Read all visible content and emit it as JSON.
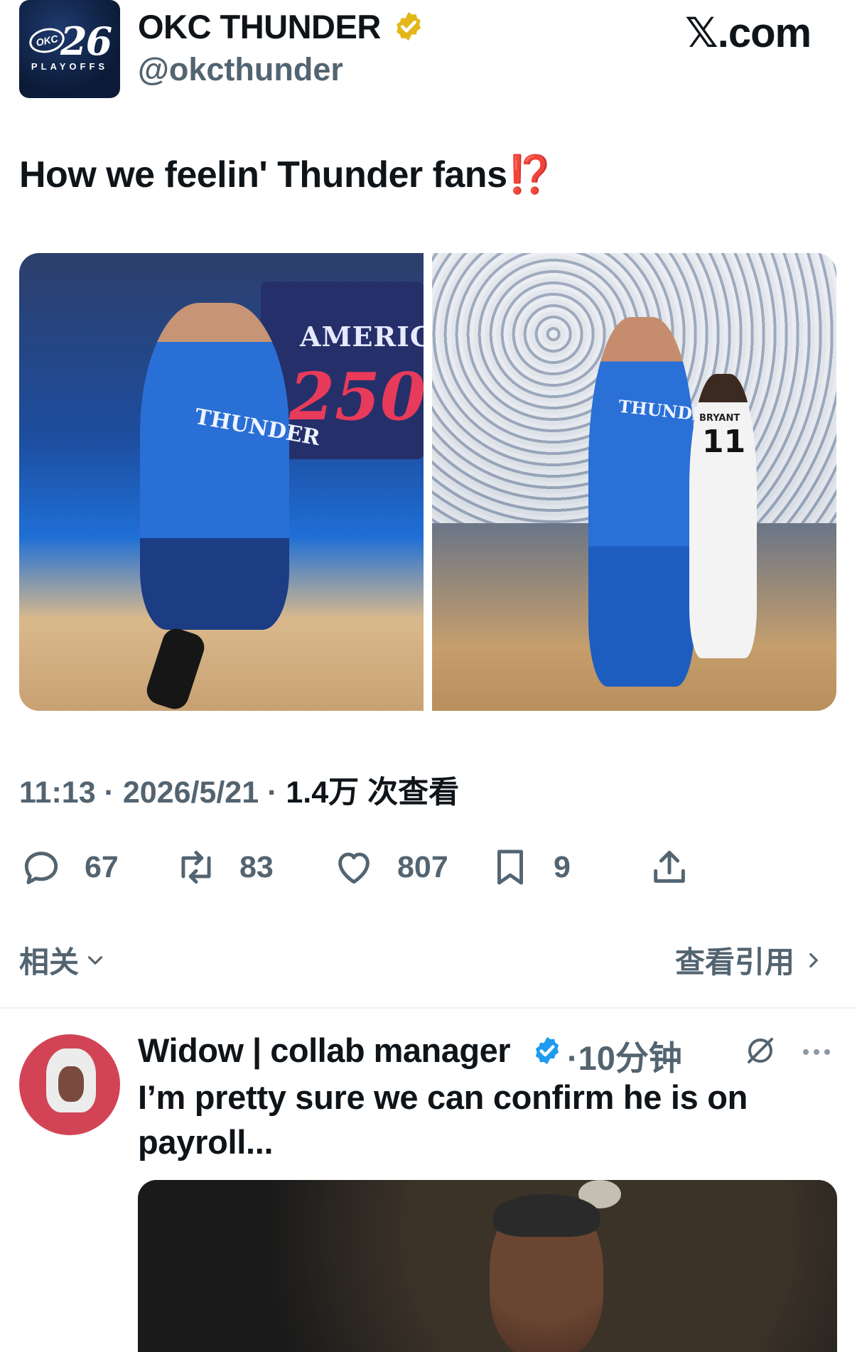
{
  "header": {
    "avatar_logo_number": "26",
    "avatar_logo_initials": "OKC",
    "avatar_logo_caption": "PLAYOFFS",
    "account_name": "OKC THUNDER",
    "handle": "@okcthunder",
    "site_label": "𝕏.com"
  },
  "tweet": {
    "text": "How we feelin' Thunder fans",
    "emoji": "⁉️",
    "photo1_board_text": "AMERICA",
    "photo1_board_number": "250",
    "photo1_jersey": "THUNDER",
    "photo2_jersey": "THUNDER",
    "photo2_opponent_name": "BRYANT",
    "photo2_opponent_number": "11",
    "time": "11:13",
    "date": "2026/5/21",
    "views": "1.4万 次查看",
    "separator": " · "
  },
  "actions": {
    "replies": "67",
    "reposts": "83",
    "likes": "807",
    "bookmarks": "9"
  },
  "related_bar": {
    "related_label": "相关",
    "quotes_label": "查看引用"
  },
  "reply": {
    "name": "Widow | collab manager",
    "time": "·10分钟",
    "text": "I’m pretty sure we can confirm he is on payroll..."
  },
  "colors": {
    "text_primary": "#0f1419",
    "text_secondary": "#536471",
    "verified_gold": "#e2b719",
    "verified_blue": "#1d9bf0",
    "thunder_blue": "#2a6fd6"
  },
  "icons": {
    "verified_gold": "verified-gold-badge-icon",
    "verified_blue": "verified-blue-badge-icon",
    "reply": "reply-bubble-icon",
    "repost": "repost-icon",
    "like": "heart-icon",
    "bookmark": "bookmark-icon",
    "share": "share-icon",
    "chevron_down": "chevron-down-icon",
    "chevron_right": "chevron-right-icon",
    "grok": "grok-icon",
    "more": "more-dots-icon"
  }
}
